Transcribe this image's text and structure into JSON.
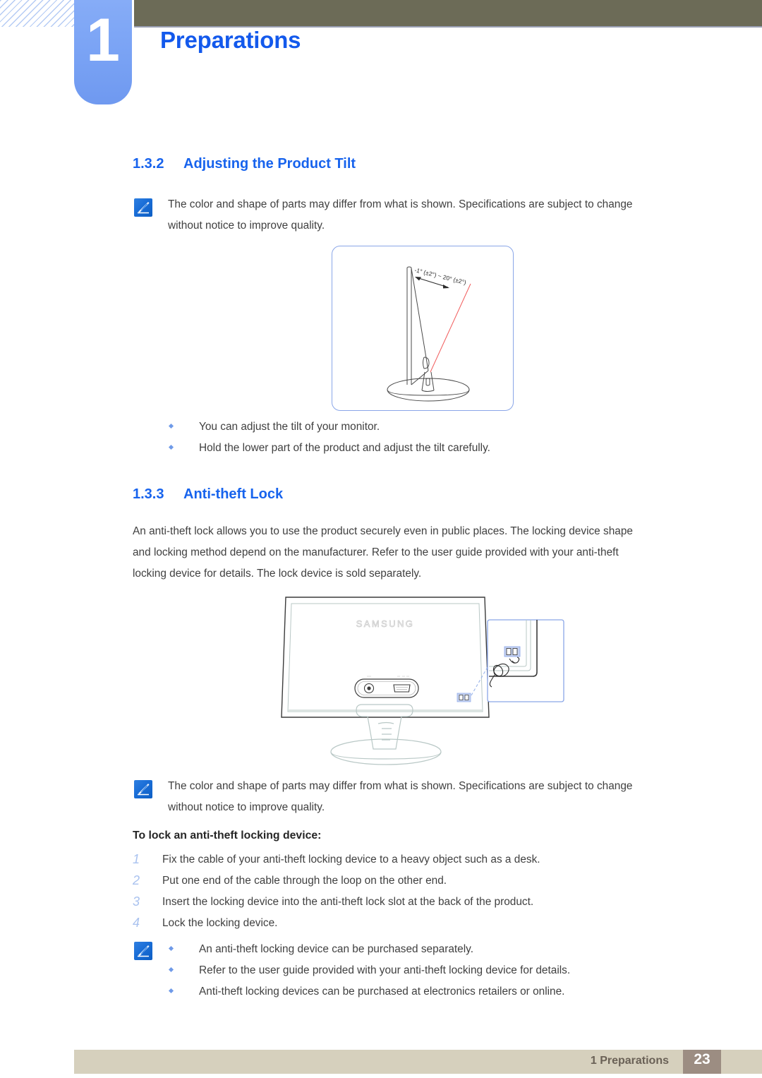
{
  "header": {
    "chapter_number": "1",
    "chapter_title": "Preparations"
  },
  "sections": [
    {
      "number": "1.3.2",
      "title": "Adjusting the Product Tilt",
      "note": "The color and shape of parts may differ from what is shown. Specifications are subject to change without notice to improve quality.",
      "bullets": [
        "You can adjust the tilt of your monitor.",
        "Hold the lower part of the product and adjust the tilt carefully."
      ],
      "figure": {
        "name": "monitor-tilt-diagram",
        "angle_label": "-1° (±2°) ~ 20° (±2°)"
      }
    },
    {
      "number": "1.3.3",
      "title": "Anti-theft Lock",
      "paragraph_lines": [
        "An anti-theft lock allows you to use the product securely even in public places. The locking device shape",
        "and locking method depend on the manufacturer. Refer to the user guide provided with your anti-theft",
        "locking device for details. The lock device is sold separately."
      ],
      "figure": {
        "name": "anti-theft-lock-diagram",
        "brand_logo": "SAMSUNG"
      },
      "note": "The color and shape of parts may differ from what is shown. Specifications are subject to change without notice to improve quality.",
      "steps_heading": "To lock an anti-theft locking device:",
      "steps": [
        {
          "number": "1",
          "text": "Fix the cable of your anti-theft locking device to a heavy object such as a desk."
        },
        {
          "number": "2",
          "text": "Put one end of the cable through the loop on the other end."
        },
        {
          "number": "3",
          "text": "Insert the locking device into the anti-theft lock slot at the back of the product."
        },
        {
          "number": "4",
          "text": "Lock the locking device."
        }
      ],
      "note_bullets": [
        "An anti-theft locking device can be purchased separately.",
        "Refer to the user guide provided with your anti-theft locking device for details.",
        "Anti-theft locking devices can be purchased at electronics retailers or online."
      ]
    }
  ],
  "note_lines": {
    "tilt_line1": "The color and shape of parts may differ from what is shown. Specifications are subject to change",
    "tilt_line2": "without notice to improve quality.",
    "lock_line1": "The color and shape of parts may differ from what is shown. Specifications are subject to change",
    "lock_line2": "without notice to improve quality."
  },
  "footer": {
    "label": "1 Preparations",
    "page_number": "23"
  },
  "colors": {
    "heading_blue": "#1763ed",
    "title_blue": "#1359ec",
    "tab_blue": "#7ba4f5",
    "olive": "#6c6b57",
    "footer_beige": "#d6d0bd",
    "footer_taupe": "#9c8d82",
    "bullet_blue": "#6f9ae8",
    "step_number_blue": "#a9c2ef",
    "callout_red": "#ef4b4b"
  }
}
